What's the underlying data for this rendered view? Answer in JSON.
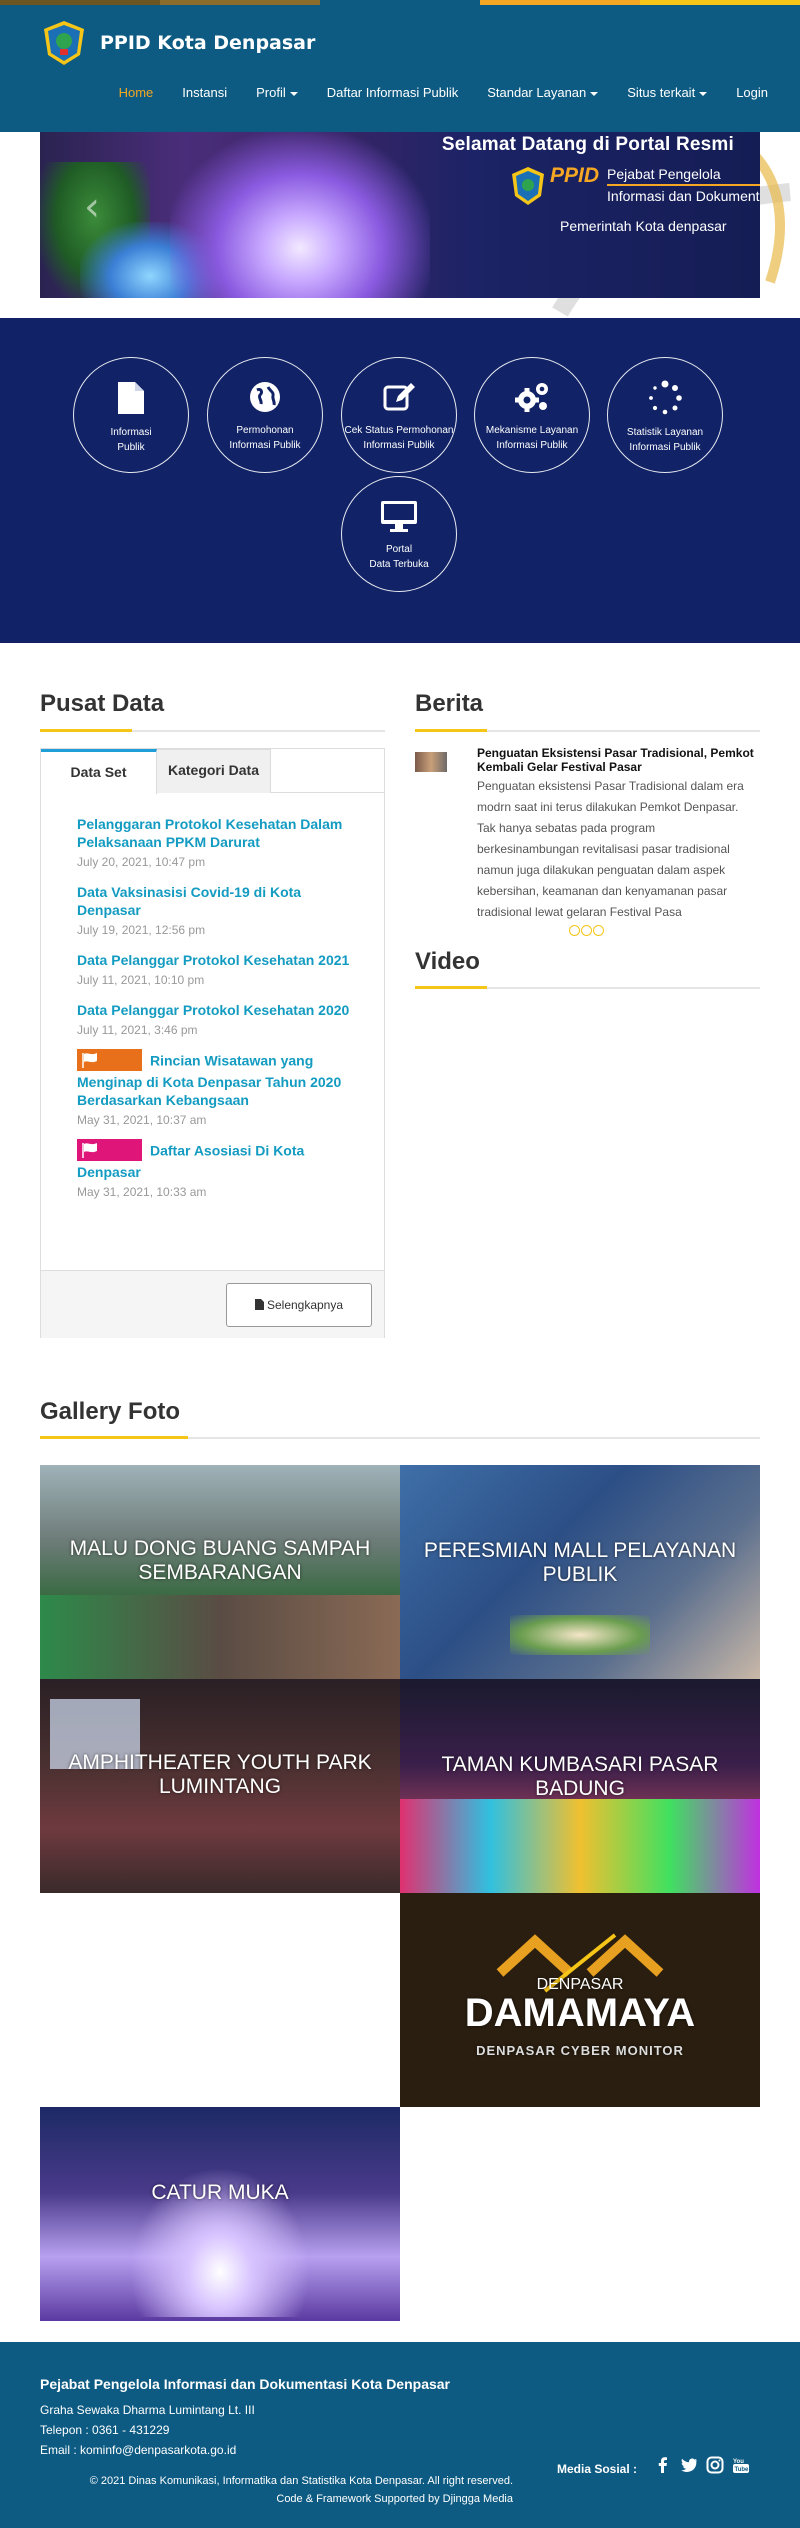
{
  "colors": {
    "header": "#0d5b82",
    "accent": "#f5a623",
    "services_bg": "#112366",
    "link": "#139bc1",
    "rule_accent": "#f5c518"
  },
  "top_strip": [
    "#8a6d2a",
    "#0d5b82",
    "#f5a623",
    "#f5c518"
  ],
  "brand": {
    "name": "PPID Kota Denpasar",
    "logo_icon": "denpasar-emblem-icon"
  },
  "nav": {
    "home": "Home",
    "instansi": "Instansi",
    "profil": "Profil",
    "daftar": "Daftar Informasi Publik",
    "standar": "Standar Layanan",
    "situs": "Situs terkait",
    "login": "Login"
  },
  "hero": {
    "title": "Selamat Datang di Portal Resmi",
    "ppid": "PPID",
    "line1": "Pejabat Pengelola",
    "line2": "Informasi dan Dokumentasi",
    "sub": "Pemerintah Kota denpasar",
    "prev_icon": "chevron-left-icon"
  },
  "services": [
    {
      "l1": "Informasi",
      "l2": "Publik",
      "icon": "document-icon"
    },
    {
      "l1": "Permohonan",
      "l2": "Informasi Publik",
      "icon": "globe-icon"
    },
    {
      "l1": "Cek Status Permohonan",
      "l2": "Informasi Publik",
      "icon": "edit-icon"
    },
    {
      "l1": "Mekanisme Layanan",
      "l2": "Informasi Publik",
      "icon": "cogs-icon"
    },
    {
      "l1": "Statistik Layanan",
      "l2": "Informasi Publik",
      "icon": "spinner-icon"
    },
    {
      "l1": "Portal",
      "l2": "Data Terbuka",
      "icon": "monitor-icon"
    }
  ],
  "pusat_data": {
    "title": "Pusat Data",
    "tab1": "Data Set",
    "tab2": "Kategori Data",
    "items": [
      {
        "title": "Pelanggaran Protokol Kesehatan Dalam Pelaksanaan PPKM Darurat",
        "date": "July 20, 2021, 10:47 pm"
      },
      {
        "title": "Data Vaksinasisi Covid-19 di Kota Denpasar",
        "date": "July 19, 2021, 12:56 pm"
      },
      {
        "title": "Data Pelanggar Protokol Kesehatan 2021",
        "date": "July 11, 2021, 10:10 pm"
      },
      {
        "title": "Data Pelanggar Protokol Kesehatan 2020",
        "date": "July 11, 2021, 3:46 pm"
      },
      {
        "title": "Rincian Wisatawan yang Menginap di Kota Denpasar Tahun 2020 Berdasarkan Kebangsaan",
        "date": "May 31, 2021, 10:37 am",
        "flag": "#e8701a"
      },
      {
        "title": "Daftar Asosiasi Di Kota Denpasar",
        "date": "May 31, 2021, 10:33 am",
        "flag": "#e0157a"
      }
    ],
    "more": "Selengkapnya"
  },
  "berita": {
    "title": "Berita",
    "headline": "Penguatan Eksistensi Pasar Tradisional, Pemkot Kembali Gelar Festival Pasar",
    "body": "Penguatan eksistensi Pasar Tradisional dalam era modrn saat ini terus dilakukan Pemkot Denpasar. Tak hanya sebatas pada program berkesinambungan revitalisasi pasar tradisional namun juga dilakukan penguatan dalam aspek kebersihan, keamanan dan kenyamanan pasar tradisional lewat gelaran Festival Pasa"
  },
  "video": {
    "title": "Video"
  },
  "gallery": {
    "title": "Gallery Foto",
    "items": [
      {
        "caption": "MALU DONG BUANG SAMPAH SEMBARANGAN"
      },
      {
        "caption": "PERESMIAN MALL PELAYANAN PUBLIK"
      },
      {
        "caption": "AMPHITHEATER YOUTH PARK LUMINTANG"
      },
      {
        "caption": "TAMAN KUMBASARI PASAR BADUNG"
      },
      {
        "caption": "DENPASAR",
        "logo": "DAMAMAYA",
        "sub": "DENPASAR CYBER MONITOR"
      },
      {
        "caption": "CATUR MUKA"
      }
    ]
  },
  "footer": {
    "org": "Pejabat Pengelola Informasi dan Dokumentasi Kota Denpasar",
    "address": "Graha Sewaka Dharma Lumintang Lt. III",
    "phone": "Telepon : 0361 - 431229",
    "email": "Email : kominfo@denpasarkota.go.id",
    "copyright": "© 2021 Dinas Komunikasi, Informatika dan Statistika Kota Denpasar. All right reserved.",
    "credit": "Code & Framework Supported by Djingga Media",
    "social_label": "Media Sosial :",
    "social_icons": [
      "facebook-icon",
      "twitter-icon",
      "instagram-icon",
      "youtube-icon"
    ]
  }
}
